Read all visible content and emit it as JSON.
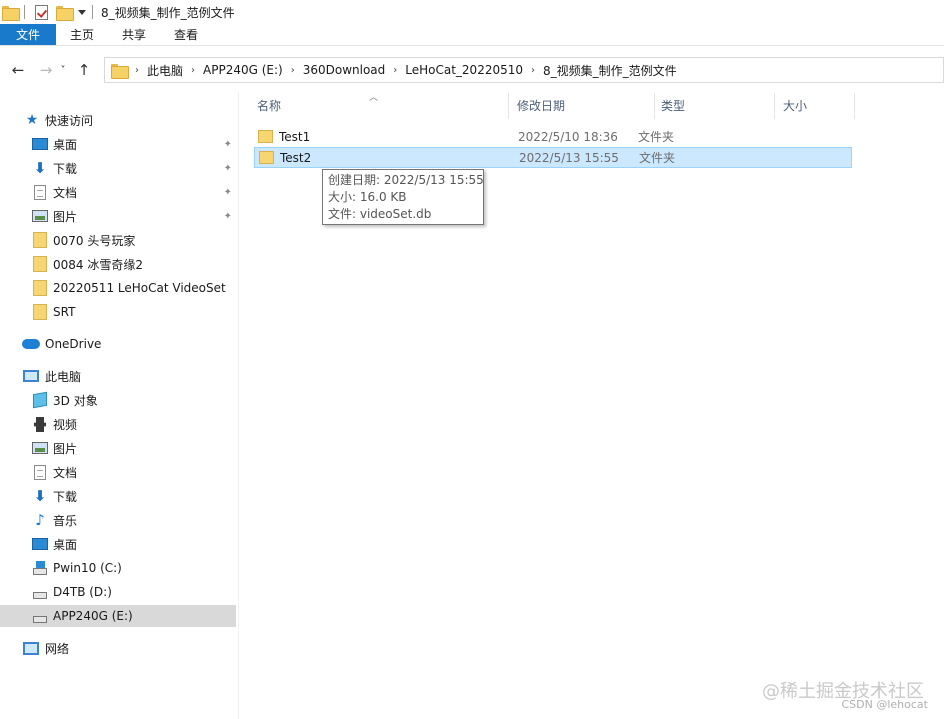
{
  "titlebar": {
    "title": "8_视频集_制作_范例文件"
  },
  "ribbon": {
    "tabs": [
      "文件",
      "主页",
      "共享",
      "查看"
    ]
  },
  "address": {
    "back_icon": "←",
    "forward_icon": "→",
    "recent_icon": "˅",
    "up_icon": "↑",
    "crumbs": [
      "此电脑",
      "APP240G (E:)",
      "360Download",
      "LeHoCat_20220510",
      "8_视频集_制作_范例文件"
    ]
  },
  "nav": {
    "quick_access": "快速访问",
    "items": [
      {
        "label": "桌面",
        "icon": "desktop-icon",
        "pinned": true
      },
      {
        "label": "下载",
        "icon": "download-icon",
        "pinned": true
      },
      {
        "label": "文档",
        "icon": "document-icon",
        "pinned": true
      },
      {
        "label": "图片",
        "icon": "picture-icon",
        "pinned": true
      },
      {
        "label": "0070 头号玩家",
        "icon": "folder-icon"
      },
      {
        "label": "0084 冰雪奇缘2",
        "icon": "folder-icon"
      },
      {
        "label": "20220511 LeHoCat VideoSet",
        "icon": "folder-icon"
      },
      {
        "label": "SRT",
        "icon": "folder-icon"
      }
    ],
    "onedrive": "OneDrive",
    "this_pc": "此电脑",
    "pc_items": [
      {
        "label": "3D 对象",
        "icon": "3d-objects-icon"
      },
      {
        "label": "视频",
        "icon": "video-icon"
      },
      {
        "label": "图片",
        "icon": "picture-icon"
      },
      {
        "label": "文档",
        "icon": "document-icon"
      },
      {
        "label": "下载",
        "icon": "download-icon"
      },
      {
        "label": "音乐",
        "icon": "music-icon"
      },
      {
        "label": "桌面",
        "icon": "desktop-icon"
      },
      {
        "label": "Pwin10 (C:)",
        "icon": "system-drive-icon"
      },
      {
        "label": "D4TB (D:)",
        "icon": "drive-icon"
      },
      {
        "label": "APP240G (E:)",
        "icon": "drive-icon",
        "selected": true
      }
    ],
    "network": "网络"
  },
  "files": {
    "columns": [
      "名称",
      "修改日期",
      "类型",
      "大小"
    ],
    "rows": [
      {
        "name": "Test1",
        "date": "2022/5/10 18:36",
        "type": "文件夹"
      },
      {
        "name": "Test2",
        "date": "2022/5/13 15:55",
        "type": "文件夹",
        "selected": true
      }
    ]
  },
  "tooltip": {
    "line1": "创建日期: 2022/5/13 15:55",
    "line2": "大小: 16.0 KB",
    "line3": "文件: videoSet.db"
  },
  "watermark": {
    "line1": "@稀土掘金技术社区",
    "line2": "CSDN @lehocat"
  },
  "colors": {
    "accent": "#1979ca",
    "selection": "#cce8ff",
    "nav_selected": "#d9d9d9"
  }
}
